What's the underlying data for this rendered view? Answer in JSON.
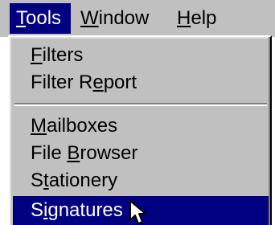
{
  "menubar": {
    "items": [
      {
        "mnemonic": "T",
        "rest": "ools",
        "active": true
      },
      {
        "mnemonic": "W",
        "rest": "indow",
        "active": false
      },
      {
        "mnemonic": "H",
        "rest": "elp",
        "active": false
      }
    ]
  },
  "tools_menu": {
    "items": [
      {
        "before": "",
        "mnemonic": "F",
        "after": "ilters"
      },
      {
        "before": "Filter R",
        "mnemonic": "e",
        "after": "port"
      },
      {
        "before": "",
        "mnemonic": "M",
        "after": "ailboxes"
      },
      {
        "before": "File ",
        "mnemonic": "B",
        "after": "rowser"
      },
      {
        "before": "S",
        "mnemonic": "t",
        "after": "ationery"
      },
      {
        "before": "S",
        "mnemonic": "i",
        "after": "gnatures",
        "selected": true
      }
    ]
  },
  "colors": {
    "menu_background": "#c0c0c0",
    "highlight": "#000080",
    "highlight_text": "#ffffff"
  },
  "icons": {
    "cursor": "arrow-pointer-icon"
  }
}
